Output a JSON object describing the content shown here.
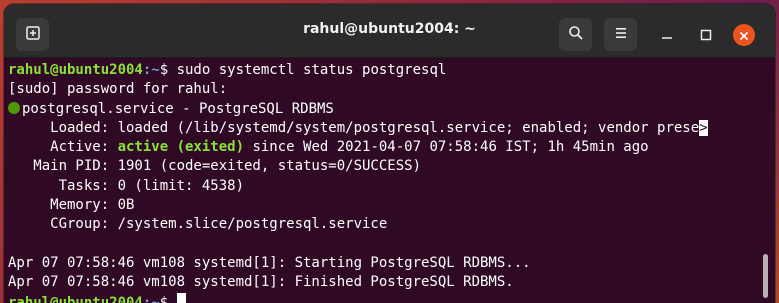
{
  "window": {
    "title": "rahul@ubuntu2004: ~"
  },
  "icons": {
    "new_tab": "new-tab-icon",
    "search": "search-icon",
    "menu": "hamburger-icon",
    "minimize": "minimize-icon",
    "maximize": "maximize-icon",
    "close": "close-icon"
  },
  "colors": {
    "terminal_bg": "#300a24",
    "prompt_user": "#8ae234",
    "prompt_path": "#729fcf",
    "close_button": "#e95420",
    "status_dot": "#4e9a06"
  },
  "terminal": {
    "prompt1": {
      "user": "rahul@ubuntu2004",
      "path": ":~",
      "symbol": "$ ",
      "command": "sudo systemctl status postgresql"
    },
    "sudo_line": "[sudo] password for rahul:",
    "service_line": "postgresql.service - PostgreSQL RDBMS",
    "loaded_line": "     Loaded: loaded (/lib/systemd/system/postgresql.service; enabled; vendor prese",
    "loaded_trunc": ">",
    "active_prefix": "     Active: ",
    "active_status": "active (exited)",
    "active_suffix": " since Wed 2021-04-07 07:58:46 IST; 1h 45min ago",
    "mainpid_line": "   Main PID: 1901 (code=exited, status=0/SUCCESS)",
    "tasks_line": "      Tasks: 0 (limit: 4538)",
    "memory_line": "     Memory: 0B",
    "cgroup_line": "     CGroup: /system.slice/postgresql.service",
    "log1": "Apr 07 07:58:46 vm108 systemd[1]: Starting PostgreSQL RDBMS...",
    "log2": "Apr 07 07:58:46 vm108 systemd[1]: Finished PostgreSQL RDBMS.",
    "prompt2": {
      "user": "rahul@ubuntu2004",
      "path": ":~",
      "symbol": "$ "
    }
  }
}
